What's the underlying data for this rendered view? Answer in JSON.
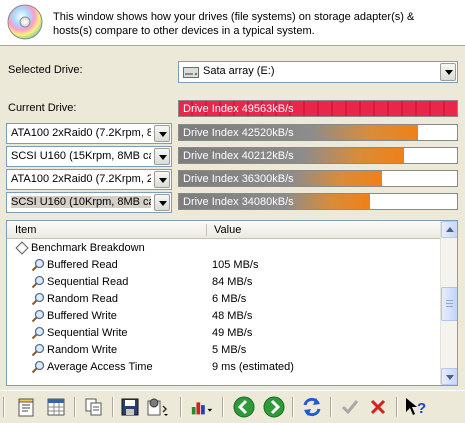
{
  "header": {
    "text": "This window shows how your drives (file systems) on storage adapter(s) & hosts(s) compare to other devices in a typical system."
  },
  "selected_drive": {
    "label": "Selected Drive:",
    "value": "Sata array (E:)"
  },
  "current_drive": {
    "label": "Current Drive:",
    "index_label": "Drive Index 49563kB/s",
    "fraction": 1.0
  },
  "comparisons": [
    {
      "device": "ATA100 2xRaid0 (7.2Krpm, 8",
      "index_label": "Drive Index 42520kB/s",
      "fraction": 0.858
    },
    {
      "device": "SCSI U160 (15Krpm, 8MB cac",
      "index_label": "Drive Index 40212kB/s",
      "fraction": 0.811
    },
    {
      "device": "ATA100 2xRaid0 (7.2Krpm, 2",
      "index_label": "Drive Index 36300kB/s",
      "fraction": 0.732
    },
    {
      "device": "SCSI U160 (10Krpm, 8MB cac",
      "index_label": "Drive Index 34080kB/s",
      "fraction": 0.688
    }
  ],
  "list": {
    "columns": [
      "Item",
      "Value"
    ],
    "group": "Benchmark Breakdown",
    "rows": [
      {
        "item": "Buffered Read",
        "value": "105 MB/s"
      },
      {
        "item": "Sequential Read",
        "value": "84 MB/s"
      },
      {
        "item": "Random Read",
        "value": "6 MB/s"
      },
      {
        "item": "Buffered Write",
        "value": "48 MB/s"
      },
      {
        "item": "Sequential Write",
        "value": "49 MB/s"
      },
      {
        "item": "Random Write",
        "value": "5 MB/s"
      },
      {
        "item": "Average Access Time",
        "value": "9 ms (estimated)"
      }
    ]
  },
  "colors": {
    "current_bar": "#e8274b",
    "compare_bar_end": "#f08018",
    "compare_bar_start": "#7d7d7d"
  },
  "toolbar": {
    "icons": [
      "report-icon",
      "spreadsheet-icon",
      "copy-icon",
      "save-icon",
      "options-icon",
      "chart-icon",
      "back-icon",
      "forward-icon",
      "refresh-icon",
      "ok-icon",
      "cancel-icon",
      "help-icon"
    ]
  }
}
